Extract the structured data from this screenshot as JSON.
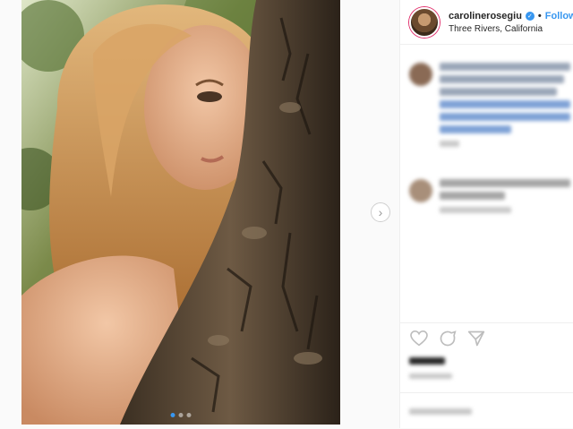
{
  "post": {
    "username": "carolinerosegiu",
    "follow_label": "Follow",
    "location": "Three Rivers, California",
    "verified_glyph": "✓",
    "carousel": {
      "count": 3,
      "active_index": 0
    },
    "next_arrow_glyph": "›"
  },
  "icons": [
    "heart-icon",
    "comment-icon",
    "share-icon"
  ],
  "colors": {
    "link_blue": "#3897f0",
    "border": "#efefef",
    "text": "#262626"
  }
}
